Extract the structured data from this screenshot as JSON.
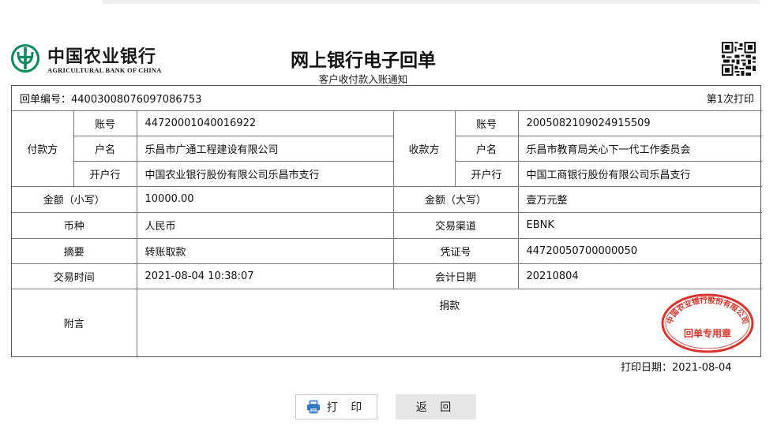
{
  "header": {
    "bank_name_cn": "中国农业银行",
    "bank_name_en": "AGRICULTURAL BANK OF CHINA",
    "title": "网上银行电子回单",
    "subtitle": "客户收付款入账通知",
    "qr_icon": "qr-code-icon"
  },
  "receipt": {
    "number_label": "回单编号：",
    "number": "44003008076097086753",
    "print_count": "第1次打印",
    "payer": {
      "label": "付款方",
      "account_label": "账号",
      "account": "44720001040016922",
      "name_label": "户名",
      "name": "乐昌市广通工程建设有限公司",
      "bank_label": "开户行",
      "bank": "中国农业银行股份有限公司乐昌市支行"
    },
    "payee": {
      "label": "收款方",
      "account_label": "账号",
      "account": "2005082109024915509",
      "name_label": "户名",
      "name": "乐昌市教育局关心下一代工作委员会",
      "bank_label": "开户行",
      "bank": "中国工商银行股份有限公司乐昌支行"
    },
    "amount_small_label": "金额（小写）",
    "amount_small": "10000.00",
    "amount_big_label": "金额（大写）",
    "amount_big": "壹万元整",
    "currency_label": "币种",
    "currency": "人民币",
    "channel_label": "交易渠道",
    "channel": "EBNK",
    "summary_label": "摘要",
    "summary": "转账取款",
    "voucher_label": "凭证号",
    "voucher": "44720050700000050",
    "trade_time_label": "交易时间",
    "trade_time": "2021-08-04 10:38:07",
    "accounting_date_label": "会计日期",
    "accounting_date": "20210804",
    "memo_label": "附言",
    "memo": "捐款",
    "seal": {
      "ring_text": "中国农业银行股份有限公司",
      "center_text": "回单专用章",
      "color": "#d9342b"
    }
  },
  "footer": {
    "print_date_label": "打印日期：",
    "print_date": "2021-08-04",
    "print_button": "打 印",
    "back_button": "返 回"
  },
  "colors": {
    "abc_green": "#0b8a5a",
    "seal_red": "#d9342b",
    "print_icon_blue": "#2f78c4"
  }
}
